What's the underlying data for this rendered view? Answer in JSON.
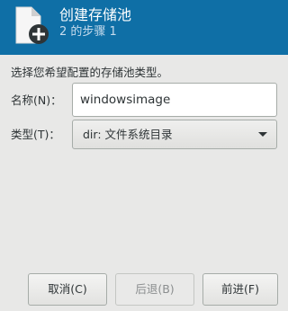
{
  "header": {
    "title": "创建存储池",
    "subtitle": "2 的步骤 1",
    "accent_color": "#0f6fa6",
    "icon": "add-storage-file-icon"
  },
  "instruction": "选择您希望配置的存储池类型。",
  "form": {
    "name_label": "名称(N)：",
    "name_value": "windowsimage",
    "type_label": "类型(T)：",
    "type_value": "dir: 文件系统目录"
  },
  "buttons": {
    "cancel": "取消(C)",
    "back": "后退(B)",
    "forward": "前进(F)"
  }
}
